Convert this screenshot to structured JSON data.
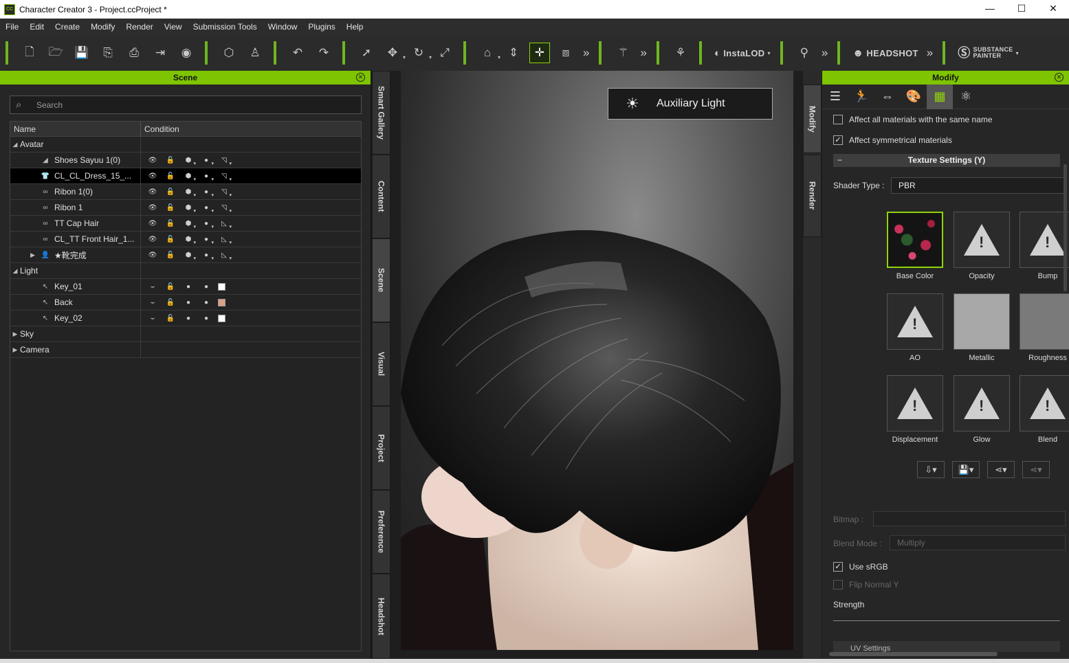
{
  "window": {
    "title": "Character Creator 3 - Project.ccProject *",
    "controls": [
      "—",
      "☐",
      "✕"
    ]
  },
  "menu": [
    "File",
    "Edit",
    "Create",
    "Modify",
    "Render",
    "View",
    "Submission Tools",
    "Window",
    "Plugins",
    "Help"
  ],
  "toolbar": {
    "brands": {
      "instalod": "InstaLOD",
      "headshot": "HEADSHOT",
      "substance_line1": "SUBSTANCE",
      "substance_line2": "PAINTER"
    },
    "more": "»"
  },
  "scene": {
    "title": "Scene",
    "search_placeholder": "Search",
    "columns": {
      "name": "Name",
      "condition": "Condition"
    },
    "rows": [
      {
        "label": "Avatar",
        "type": "group",
        "expanded": true
      },
      {
        "label": "Shoes Sayuu 1(0)",
        "type": "item"
      },
      {
        "label": "CL_CL_Dress_15_...",
        "type": "item",
        "selected": true
      },
      {
        "label": "Ribon 1(0)",
        "type": "item"
      },
      {
        "label": "Ribon 1",
        "type": "item"
      },
      {
        "label": "TT Cap Hair",
        "type": "item"
      },
      {
        "label": "CL_TT Front Hair_1...",
        "type": "item"
      },
      {
        "label": "★靴完成",
        "type": "item",
        "collapsed": true
      },
      {
        "label": "Light",
        "type": "group",
        "expanded": true
      },
      {
        "label": "Key_01",
        "type": "light",
        "color": "#ffffff"
      },
      {
        "label": "Back",
        "type": "light",
        "color": "#d9a088"
      },
      {
        "label": "Key_02",
        "type": "light",
        "color": "#ffffff"
      },
      {
        "label": "Sky",
        "type": "group",
        "expanded": false
      },
      {
        "label": "Camera",
        "type": "group",
        "expanded": false
      }
    ]
  },
  "vtabs": [
    "Smart Gallery",
    "Content",
    "Scene",
    "Visual",
    "Project",
    "Preference",
    "Headshot"
  ],
  "viewport": {
    "aux_light": "Auxiliary Light"
  },
  "side_tabs": [
    "Modify",
    "Render"
  ],
  "modify": {
    "title": "Modify",
    "affect_same_name": "Affect all materials with the same name",
    "affect_symmetrical": "Affect symmetrical materials",
    "section": "Texture Settings  (Y)",
    "shader_label": "Shader Type :",
    "shader_value": "PBR",
    "textures": [
      "Base Color",
      "Opacity",
      "Bump",
      "AO",
      "Metallic",
      "Roughness",
      "Displacement",
      "Glow",
      "Blend"
    ],
    "bitmap_label": "Bitmap :",
    "blend_mode_label": "Blend Mode :",
    "blend_mode_value": "Multiply",
    "use_srgb": "Use sRGB",
    "flip_normal": "Flip Normal Y",
    "strength": "Strength",
    "uv_settings": "UV Settings"
  }
}
